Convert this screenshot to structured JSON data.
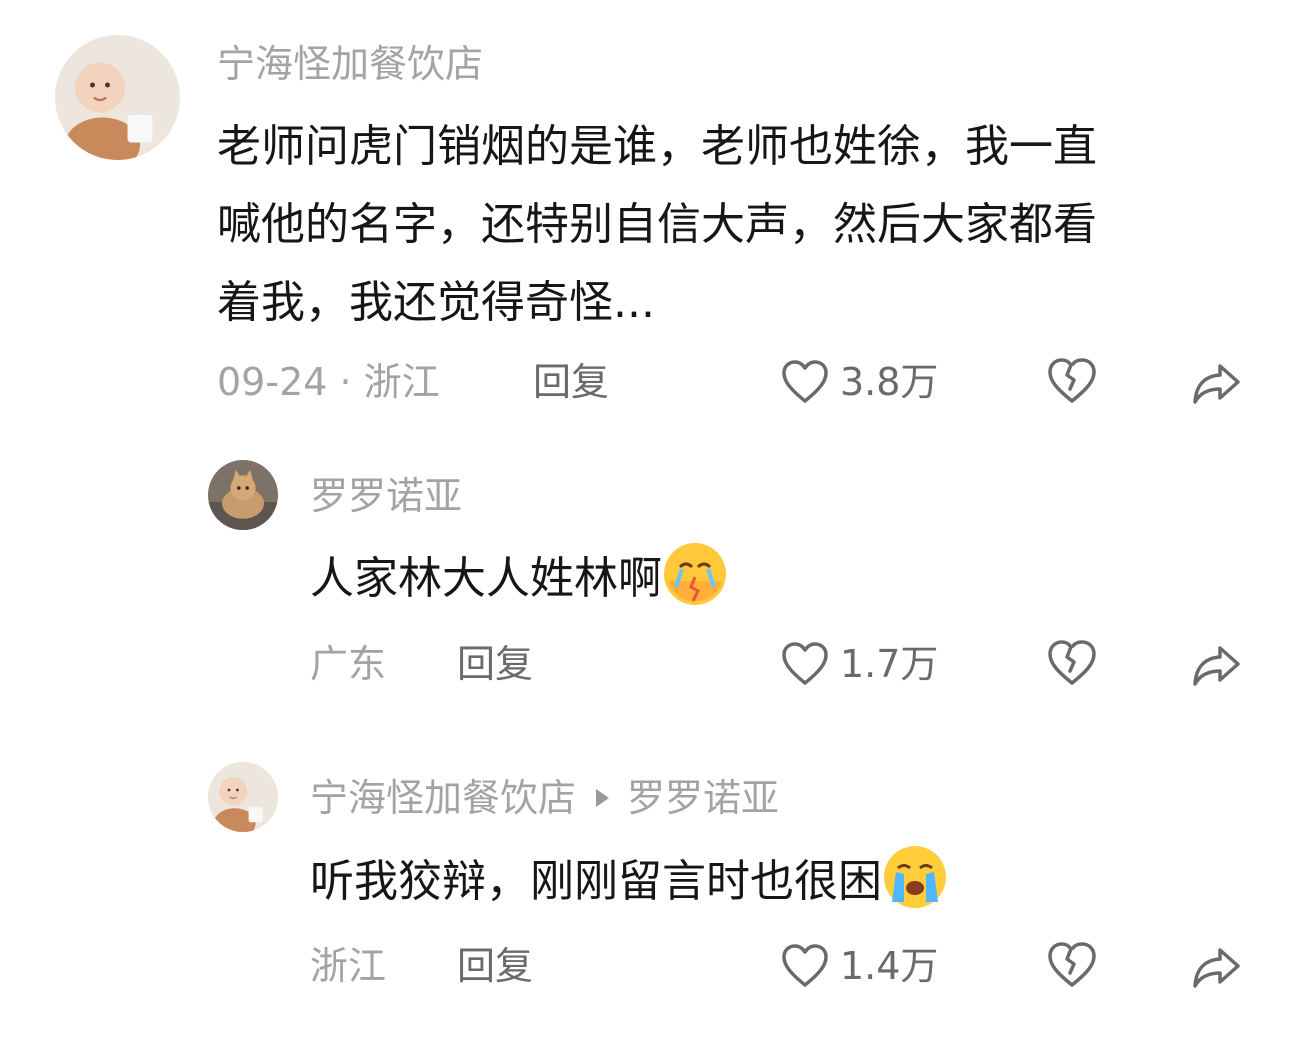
{
  "comments": [
    {
      "user": "宁海怪加餐饮店",
      "text": "老师问虎门销烟的是谁，老师也姓徐，我一直\n喊他的名字，还特别自信大声，然后大家都看\n着我，我还觉得奇怪...",
      "meta": "09-24 · 浙江",
      "reply_label": "回复",
      "likes": "3.8万",
      "avatar_icon": "baby-avatar"
    },
    {
      "user": "罗罗诺亚",
      "text": "人家林大人姓林啊",
      "emoji": "crying-heartbroken-emoji",
      "meta": "广东",
      "reply_label": "回复",
      "likes": "1.7万",
      "avatar_icon": "cat-avatar"
    },
    {
      "user": "宁海怪加餐饮店",
      "reply_to": "罗罗诺亚",
      "text": "听我狡辩，刚刚留言时也很困",
      "emoji": "loudly-crying-emoji",
      "meta": "浙江",
      "reply_label": "回复",
      "likes": "1.4万",
      "avatar_icon": "baby-avatar"
    }
  ],
  "icons": {
    "like": "heart-outline-icon",
    "dislike": "broken-heart-icon",
    "share": "share-arrow-icon"
  }
}
